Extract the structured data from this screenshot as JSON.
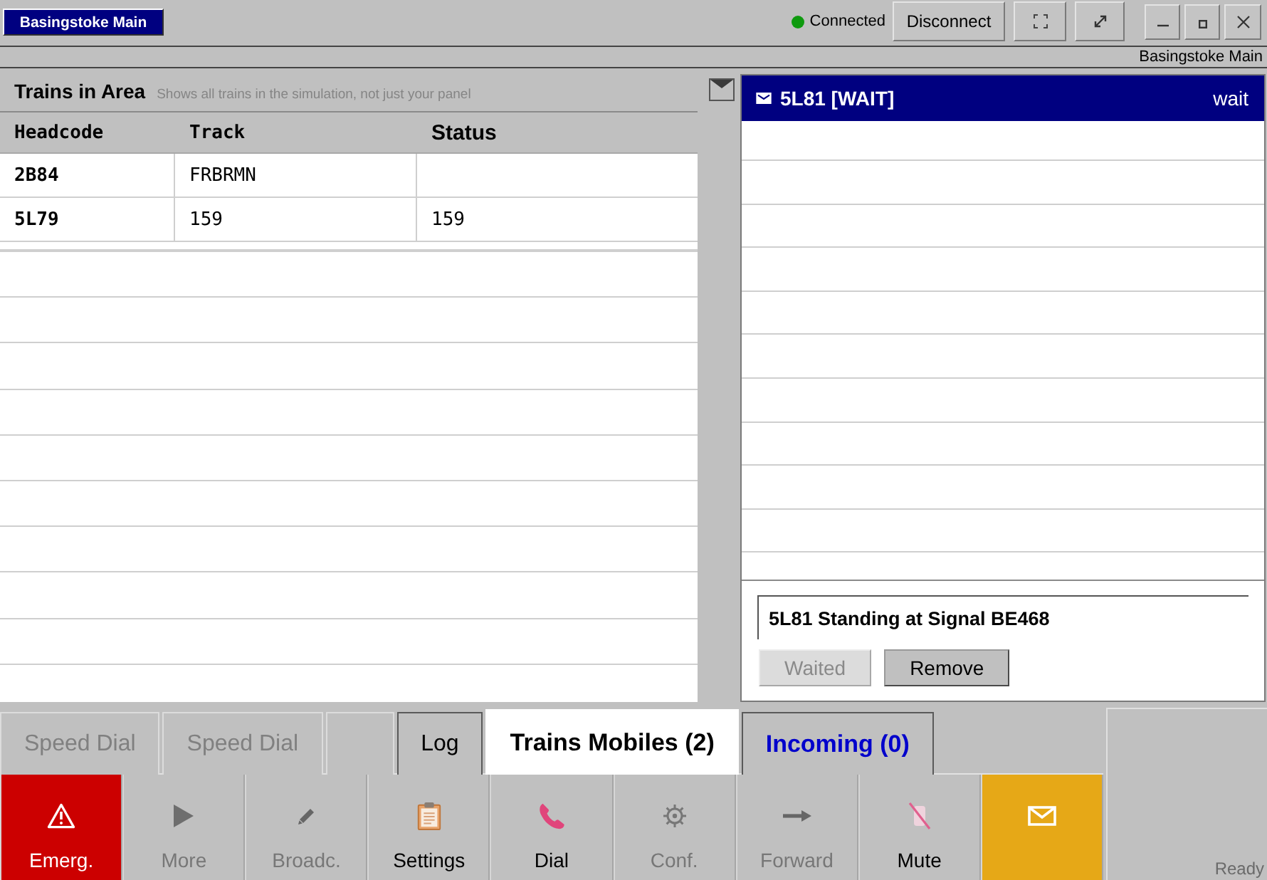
{
  "top_bar": {
    "panel_button": "Basingstoke Main",
    "connection": {
      "label": "Connected",
      "connected": true
    },
    "disconnect_button": "Disconnect"
  },
  "location_strip": {
    "label": "Basingstoke Main"
  },
  "trains_panel": {
    "title": "Trains in Area",
    "subtitle": "Shows all trains in the simulation, not just your panel",
    "columns": [
      "Headcode",
      "Track",
      "Status"
    ],
    "rows": [
      {
        "headcode": "2B84",
        "track": "FRBRMN"
      },
      {
        "headcode": "5L79",
        "track": "159",
        "status": "159"
      }
    ]
  },
  "message_panel": {
    "title": "5L81 [WAIT]",
    "status": "wait",
    "message": "5L81 Standing at Signal BE468",
    "buttons": [
      {
        "label": "Waited",
        "disabled": true
      },
      {
        "label": "Remove",
        "disabled": false
      }
    ]
  },
  "tabs": [
    {
      "label": "Speed Dial",
      "selected": false,
      "disabled": true,
      "alert": false
    },
    {
      "label": "Speed Dial",
      "selected": false,
      "disabled": true,
      "alert": false
    },
    {
      "selected": false,
      "disabled": true,
      "alert": false
    },
    {
      "label": "Log",
      "selected": false,
      "disabled": false,
      "alert": false
    },
    {
      "label": "Trains Mobiles (2)",
      "selected": true,
      "disabled": false,
      "alert": false
    },
    {
      "label": "Incoming (0)",
      "selected": false,
      "disabled": false,
      "alert": true
    }
  ],
  "toolbar": [
    {
      "kind": "emergency",
      "label": "Emerg.",
      "disabled": false
    },
    {
      "kind": "more",
      "label": "More",
      "disabled": true
    },
    {
      "kind": "broadcast",
      "label": "Broadc.",
      "disabled": true
    },
    {
      "kind": "settings",
      "label": "Settings",
      "disabled": false
    },
    {
      "kind": "dial",
      "label": "Dial",
      "disabled": false
    },
    {
      "kind": "conference",
      "label": "Conf.",
      "disabled": true
    },
    {
      "kind": "forward",
      "label": "Forward",
      "disabled": true
    },
    {
      "kind": "mute",
      "label": "Mute",
      "disabled": false
    },
    {
      "kind": "messages",
      "disabled": false
    }
  ],
  "status_bar": {
    "text": "Ready"
  }
}
